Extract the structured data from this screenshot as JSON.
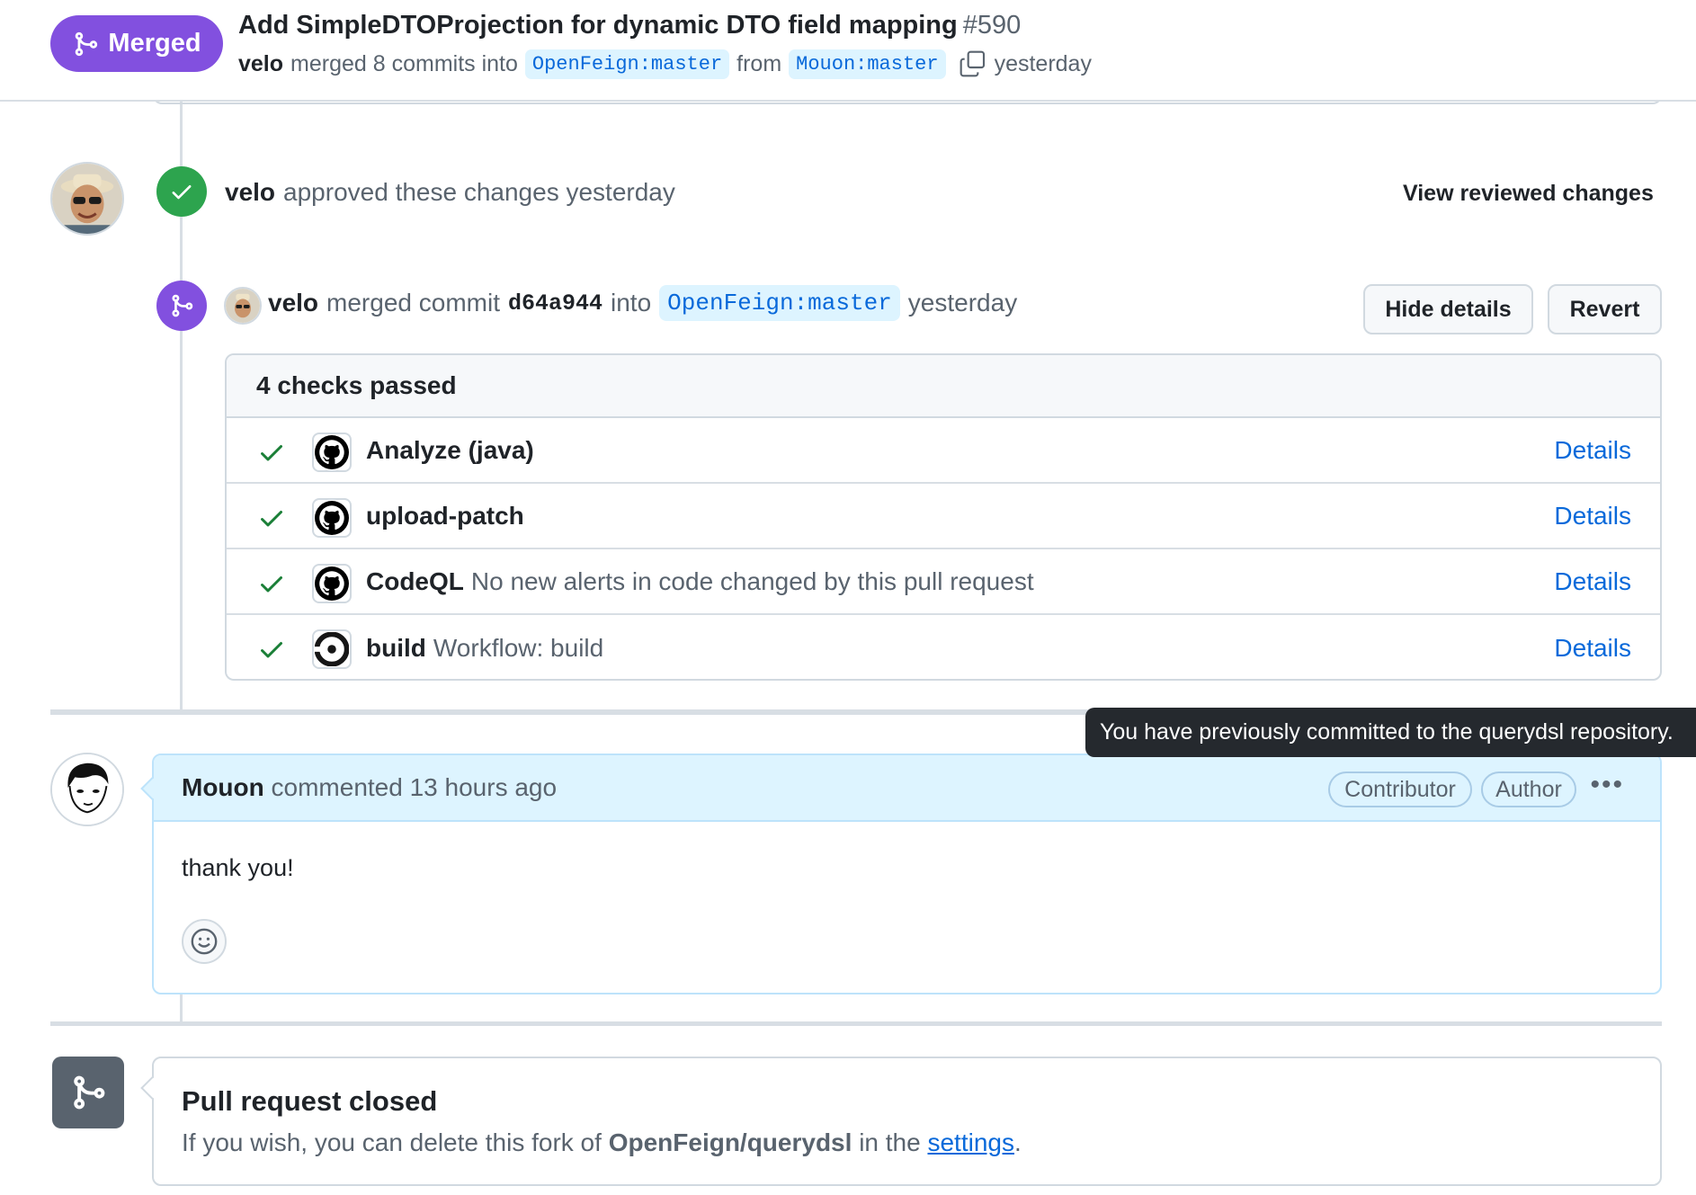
{
  "header": {
    "status_label": "Merged",
    "title": "Add SimpleDTOProjection for dynamic DTO field mapping",
    "number": "#590",
    "meta": {
      "user": "velo",
      "action": "merged 8 commits into",
      "base_branch": "OpenFeign:master",
      "from_word": "from",
      "head_branch": "Mouon:master",
      "time": "yesterday"
    }
  },
  "review": {
    "user": "velo",
    "text": "approved these changes yesterday",
    "action_label": "View reviewed changes"
  },
  "merge_event": {
    "user": "velo",
    "text": "merged commit",
    "commit": "d64a944",
    "into_word": "into",
    "branch": "OpenFeign:master",
    "time": "yesterday",
    "hide_details_label": "Hide details",
    "revert_label": "Revert"
  },
  "checks": {
    "summary": "4 checks passed",
    "items": [
      {
        "name": "Analyze (java)",
        "desc": "",
        "link": "Details",
        "icon": "github-icon"
      },
      {
        "name": "upload-patch",
        "desc": "",
        "link": "Details",
        "icon": "github-icon"
      },
      {
        "name": "CodeQL",
        "desc": "No new alerts in code changed by this pull request",
        "link": "Details",
        "icon": "github-icon"
      },
      {
        "name": "build",
        "desc": "Workflow: build",
        "link": "Details",
        "icon": "circleci-icon"
      }
    ]
  },
  "tooltip": "You have previously committed to the querydsl repository.",
  "comment": {
    "user": "Mouon",
    "meta": "commented 13 hours ago",
    "labels": [
      "Contributor",
      "Author"
    ],
    "more": "•••",
    "body": "thank you!"
  },
  "closed": {
    "title": "Pull request closed",
    "text_before": "If you wish, you can delete this fork of",
    "repo": "OpenFeign/querydsl",
    "text_middle": "in the",
    "link": "settings",
    "text_after": "."
  },
  "colors": {
    "merged": "#8250df",
    "success": "#2da44e",
    "link": "#0969da",
    "closed": "#59636e"
  }
}
